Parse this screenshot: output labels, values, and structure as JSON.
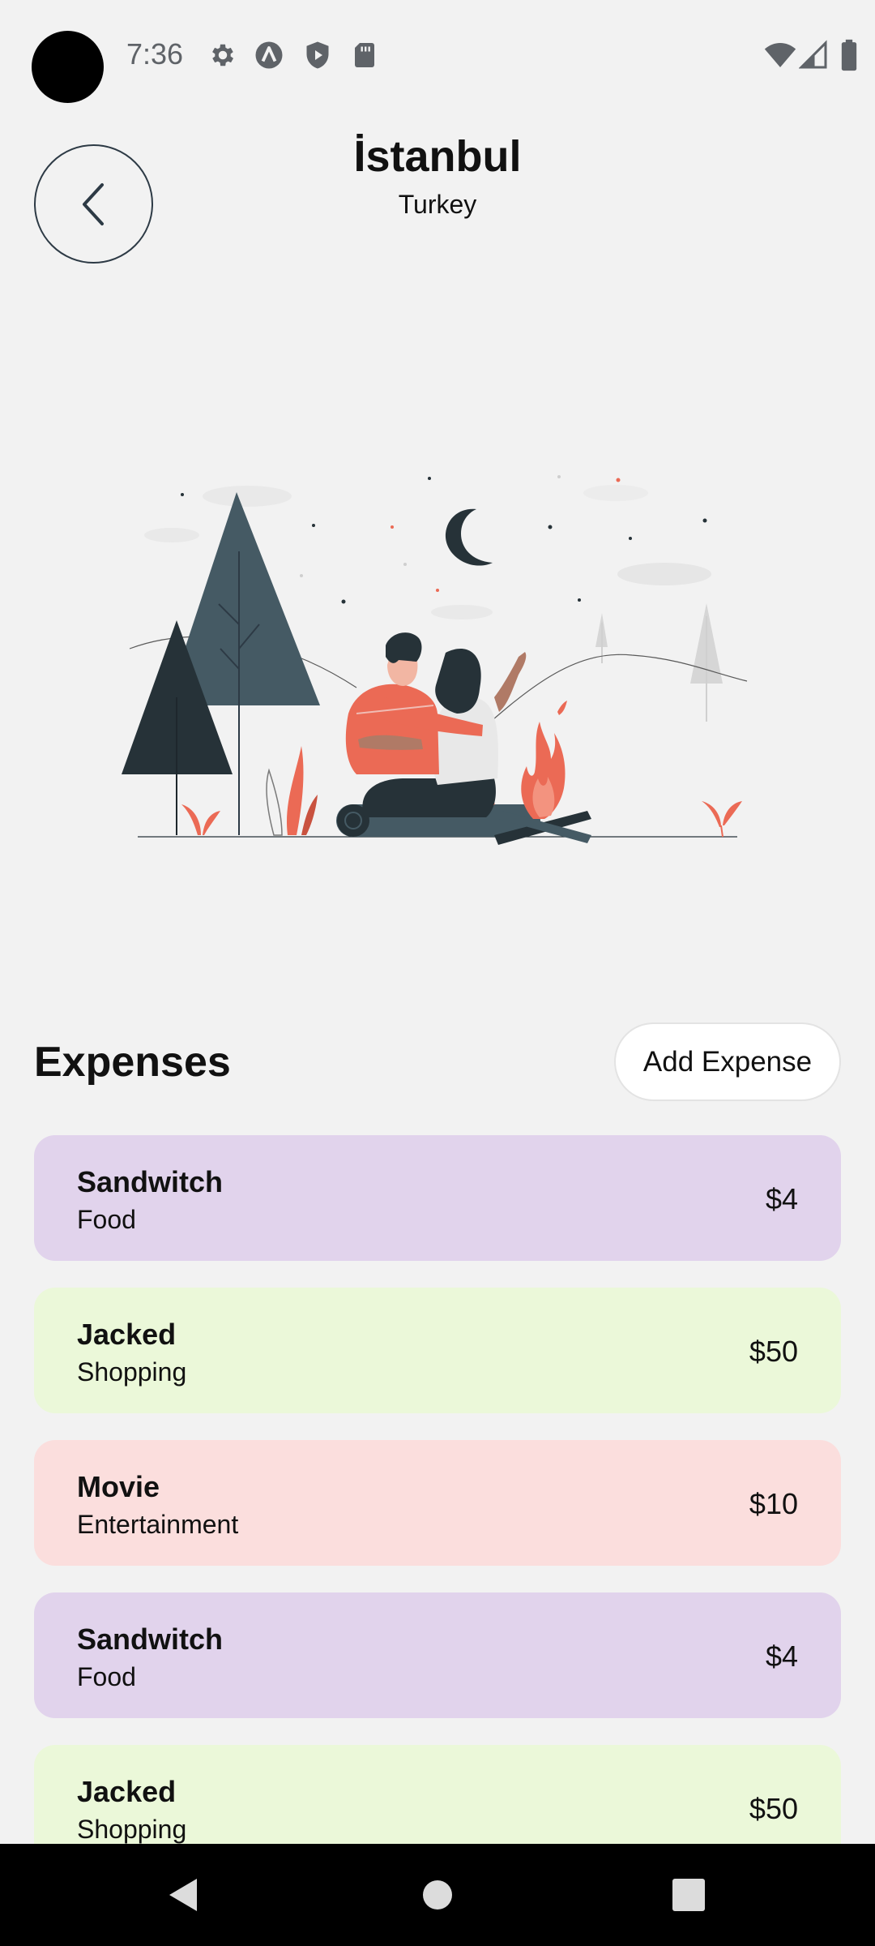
{
  "status_bar": {
    "time": "7:36",
    "left_icons": [
      "gear-icon",
      "app-a-icon",
      "shield-play-icon",
      "sd-card-icon"
    ],
    "right_icons": [
      "wifi-icon",
      "signal-icon",
      "battery-icon"
    ]
  },
  "header": {
    "back_icon": "chevron-left-icon",
    "city": "İstanbul",
    "country": "Turkey"
  },
  "hero": {
    "illustration": "couple-campfire-night-illustration"
  },
  "expenses": {
    "title": "Expenses",
    "add_label": "Add Expense",
    "items": [
      {
        "name": "Sandwitch",
        "category": "Food",
        "amount": "$4",
        "color": "#e1d3ec"
      },
      {
        "name": "Jacked",
        "category": "Shopping",
        "amount": "$50",
        "color": "#ebf8d9"
      },
      {
        "name": "Movie",
        "category": "Entertainment",
        "amount": "$10",
        "color": "#fbdedd"
      },
      {
        "name": "Sandwitch",
        "category": "Food",
        "amount": "$4",
        "color": "#e1d3ec"
      },
      {
        "name": "Jacked",
        "category": "Shopping",
        "amount": "$50",
        "color": "#ebf8d9"
      }
    ]
  },
  "nav_bar": {
    "icons": [
      "nav-back-icon",
      "nav-home-icon",
      "nav-recents-icon"
    ]
  }
}
